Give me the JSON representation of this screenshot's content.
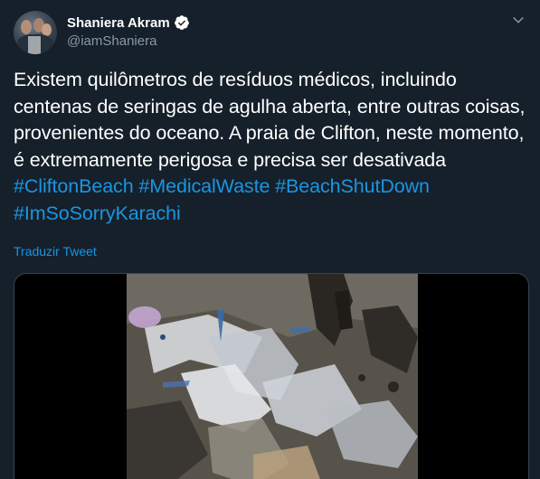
{
  "tweet": {
    "display_name": "Shaniera Akram",
    "handle": "@iamShaniera",
    "verified": true,
    "text_plain": "Existem quilômetros de resíduos médicos, incluindo centenas de seringas de agulha aberta, entre outras coisas, provenientes do oceano. A praia de Clifton, neste momento, é extremamente perigosa e precisa ser desativada ",
    "hashtags": [
      "#CliftonBeach",
      "#MedicalWaste",
      "#BeachShutDown",
      "#ImSoSorryKarachi"
    ],
    "translate_label": "Traduzir Tweet"
  },
  "icons": {
    "verified": "verified-badge-icon",
    "more": "chevron-down-icon"
  },
  "colors": {
    "background": "#15202b",
    "text": "#ffffff",
    "secondary": "#8899a6",
    "link": "#1b95e0",
    "border": "#38444d"
  }
}
